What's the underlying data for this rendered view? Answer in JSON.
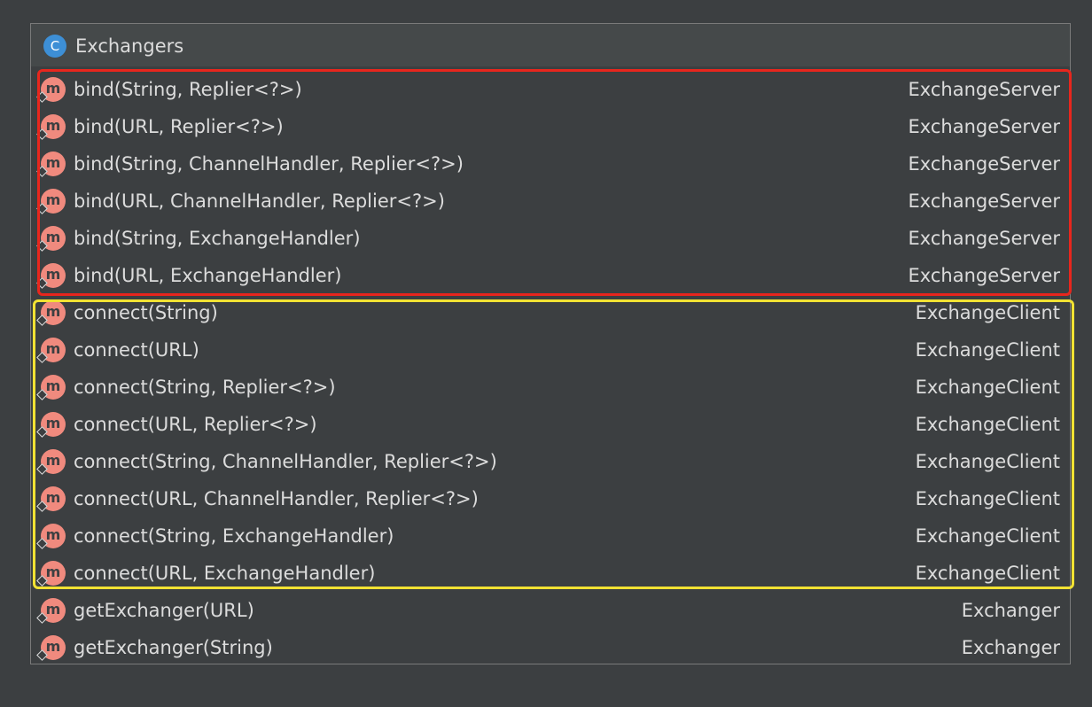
{
  "header": {
    "icon_letter": "C",
    "title": "Exchangers"
  },
  "method_icon_letter": "m",
  "methods": [
    {
      "signature": "bind(String, Replier<?>)",
      "return_type": "ExchangeServer"
    },
    {
      "signature": "bind(URL, Replier<?>)",
      "return_type": "ExchangeServer"
    },
    {
      "signature": "bind(String, ChannelHandler, Replier<?>)",
      "return_type": "ExchangeServer"
    },
    {
      "signature": "bind(URL, ChannelHandler, Replier<?>)",
      "return_type": "ExchangeServer"
    },
    {
      "signature": "bind(String, ExchangeHandler)",
      "return_type": "ExchangeServer"
    },
    {
      "signature": "bind(URL, ExchangeHandler)",
      "return_type": "ExchangeServer"
    },
    {
      "signature": "connect(String)",
      "return_type": "ExchangeClient"
    },
    {
      "signature": "connect(URL)",
      "return_type": "ExchangeClient"
    },
    {
      "signature": "connect(String, Replier<?>)",
      "return_type": "ExchangeClient"
    },
    {
      "signature": "connect(URL, Replier<?>)",
      "return_type": "ExchangeClient"
    },
    {
      "signature": "connect(String, ChannelHandler, Replier<?>)",
      "return_type": "ExchangeClient"
    },
    {
      "signature": "connect(URL, ChannelHandler, Replier<?>)",
      "return_type": "ExchangeClient"
    },
    {
      "signature": "connect(String, ExchangeHandler)",
      "return_type": "ExchangeClient"
    },
    {
      "signature": "connect(URL, ExchangeHandler)",
      "return_type": "ExchangeClient"
    },
    {
      "signature": "getExchanger(URL)",
      "return_type": "Exchanger"
    },
    {
      "signature": "getExchanger(String)",
      "return_type": "Exchanger"
    }
  ],
  "colors": {
    "background": "#3c3f41",
    "class_icon": "#3d8fd6",
    "method_icon": "#f08a7e",
    "highlight_bind_group": "#e8261d",
    "highlight_connect_group": "#f2e233"
  }
}
